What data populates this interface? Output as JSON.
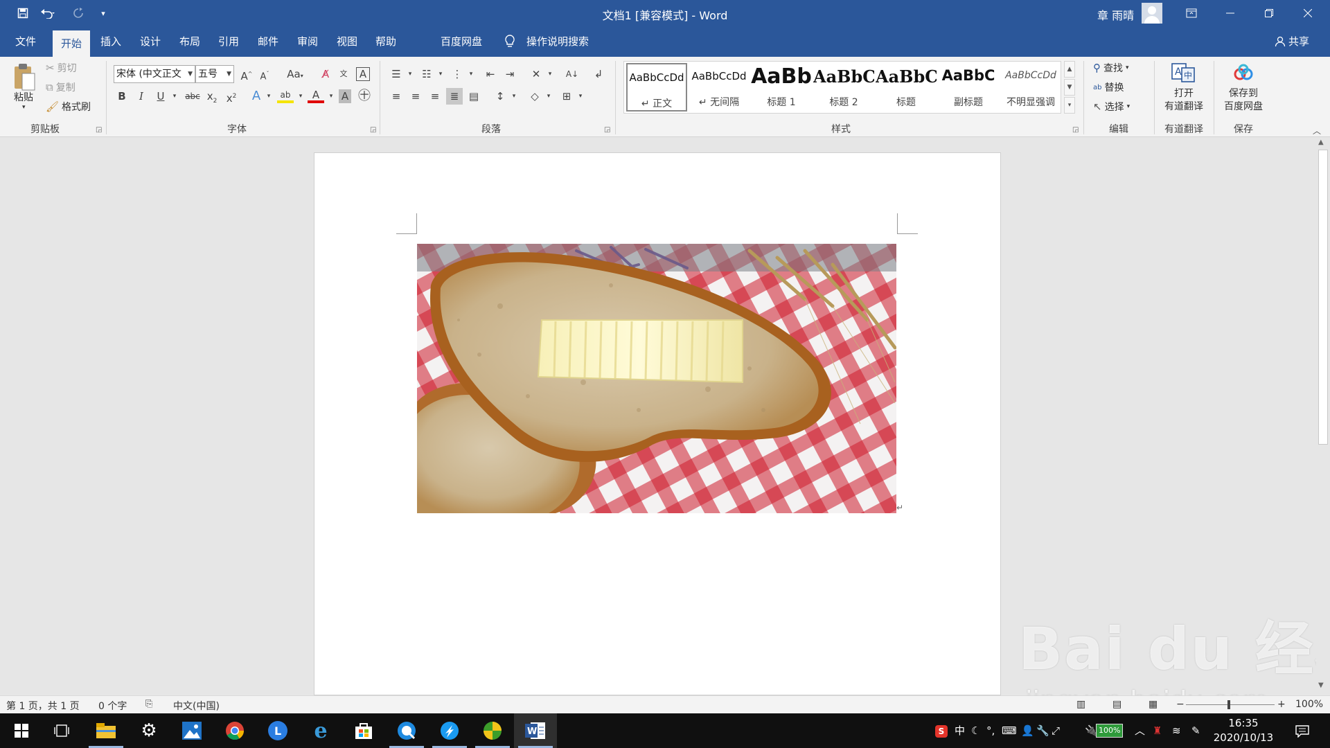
{
  "window": {
    "title": "文档1 [兼容模式]  -  Word",
    "user_name": "章 雨晴",
    "accent_color": "#2b579a"
  },
  "quick_access": [
    "save-icon",
    "undo-icon",
    "redo-icon",
    "customize-icon"
  ],
  "tabs": [
    {
      "label": "文件"
    },
    {
      "label": "开始",
      "active": true
    },
    {
      "label": "插入"
    },
    {
      "label": "设计"
    },
    {
      "label": "布局"
    },
    {
      "label": "引用"
    },
    {
      "label": "邮件"
    },
    {
      "label": "审阅"
    },
    {
      "label": "视图"
    },
    {
      "label": "帮助"
    },
    {
      "label": "百度网盘"
    }
  ],
  "tell_me": "操作说明搜索",
  "share": "共享",
  "ribbon": {
    "clipboard": {
      "paste": "粘贴",
      "cut": "剪切",
      "copy": "复制",
      "format_painter": "格式刷",
      "label": "剪贴板"
    },
    "font": {
      "font_name": "宋体 (中文正文",
      "font_size": "五号",
      "change_case": "Aa",
      "strikethrough": "abc",
      "label": "字体"
    },
    "paragraph": {
      "label": "段落"
    },
    "styles": {
      "label": "样式",
      "items": [
        {
          "sample": "AaBbCcDd",
          "name": "↵ 正文",
          "selected": true
        },
        {
          "sample": "AaBbCcDd",
          "name": "↵ 无间隔"
        },
        {
          "sample": "AaBb",
          "name": "标题 1"
        },
        {
          "sample": "AaBbC",
          "name": "标题 2"
        },
        {
          "sample": "AaBbC",
          "name": "标题"
        },
        {
          "sample": "AaBbC",
          "name": "副标题"
        },
        {
          "sample": "AaBbCcDd",
          "name": "不明显强调"
        }
      ]
    },
    "editing": {
      "find": "查找",
      "replace": "替换",
      "select": "选择",
      "label": "编辑"
    },
    "youdao": {
      "button": "打开\n有道翻译",
      "label": "有道翻译"
    },
    "baidu_save": {
      "button": "保存到\n百度网盘",
      "label": "保存"
    }
  },
  "document": {
    "image_description_name": "bread-butter-photo"
  },
  "status": {
    "page": "第 1 页，共 1 页",
    "words": "0 个字",
    "language": "中文(中国)",
    "zoom": "100%"
  },
  "taskbar": {
    "apps": [
      "windows-start-icon",
      "task-view-icon",
      "file-explorer-icon",
      "settings-icon",
      "photos-icon",
      "chrome-icon",
      "l-app-icon",
      "ie-icon",
      "store-icon",
      "browser-icon",
      "feiyu-icon",
      "green-app-icon",
      "word-icon"
    ],
    "battery": "100%",
    "ime": "中",
    "time": "16:35",
    "date": "2020/10/13"
  },
  "watermark": {
    "text": "Bai du 经验",
    "url": "jingyan.baidu.com"
  }
}
